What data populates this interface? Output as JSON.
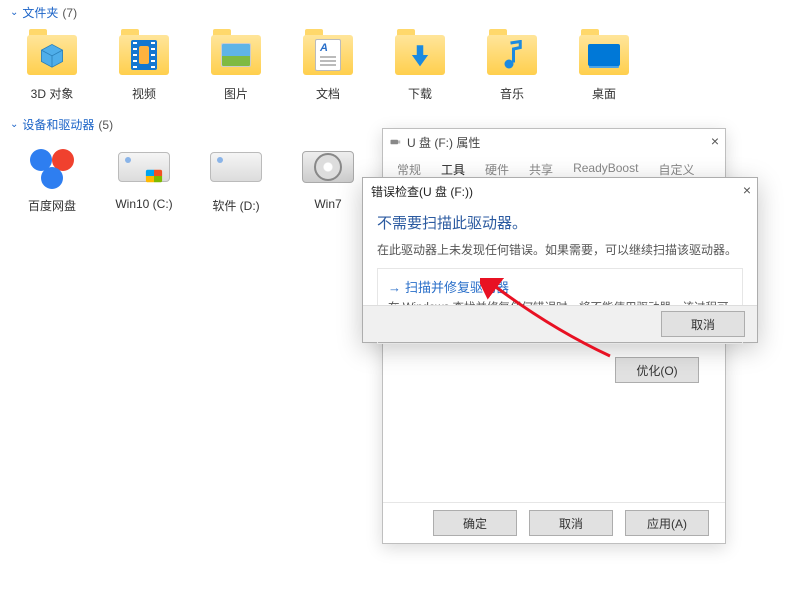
{
  "sections": {
    "folders": {
      "title": "文件夹",
      "count": "(7)"
    },
    "devices": {
      "title": "设备和驱动器",
      "count": "(5)"
    }
  },
  "folders": [
    {
      "label": "3D 对象"
    },
    {
      "label": "视频"
    },
    {
      "label": "图片"
    },
    {
      "label": "文档"
    },
    {
      "label": "下载"
    },
    {
      "label": "音乐"
    },
    {
      "label": "桌面"
    }
  ],
  "devices": [
    {
      "label": "百度网盘"
    },
    {
      "label": "Win10 (C:)"
    },
    {
      "label": "软件 (D:)"
    },
    {
      "label": "Win7"
    }
  ],
  "properties": {
    "title": "U 盘 (F:) 属性",
    "tabs": [
      {
        "label": "常规"
      },
      {
        "label": "工具",
        "active": true
      },
      {
        "label": "硬件"
      },
      {
        "label": "共享"
      },
      {
        "label": "ReadyBoost"
      },
      {
        "label": "自定义"
      }
    ],
    "optimize_label": "优化(O)",
    "ok_label": "确定",
    "cancel_label": "取消",
    "apply_label": "应用(A)"
  },
  "error_check": {
    "title": "错误检查(U 盘 (F:))",
    "heading": "不需要扫描此驱动器。",
    "sub": "在此驱动器上未发现任何错误。如果需要，可以继续扫描该驱动器。",
    "scan_link": "扫描并修复驱动器",
    "scan_desc": "在 Windows 查找并修复任何错误时，将不能使用驱动器。该过程可能需要一段时间，你可能需要重新启动计算机。",
    "cancel_label": "取消"
  }
}
